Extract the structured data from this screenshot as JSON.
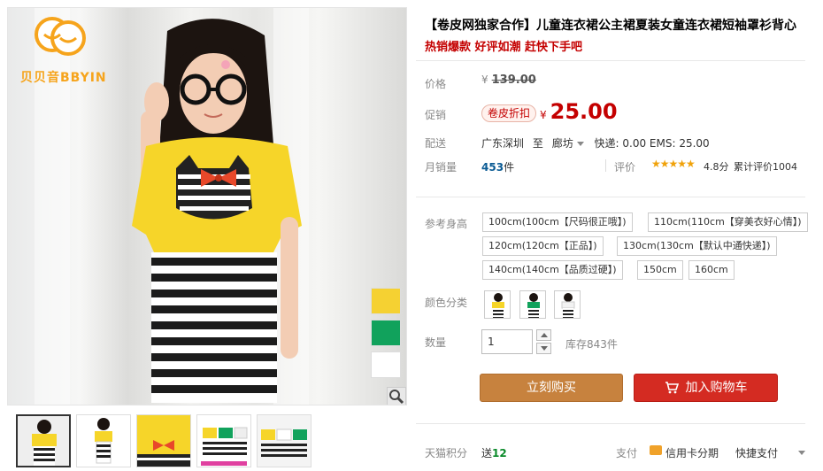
{
  "logo": {
    "brand_text": "贝贝音BBYIN"
  },
  "product": {
    "title": "【卷皮网独家合作】儿童连衣裙公主裙夏装女童连衣裙短袖罩衫背心",
    "subtitle": "热销爆款 好评如潮 赶快下手吧"
  },
  "price": {
    "label": "价格",
    "currency": "¥",
    "original": "139.00"
  },
  "promo": {
    "label": "促销",
    "badge": "卷皮折扣",
    "currency": "¥",
    "price": "25.00"
  },
  "shipping": {
    "label": "配送",
    "from": "广东深圳",
    "to_word": "至",
    "destination": "廊坊",
    "fees": "快递: 0.00 EMS: 25.00"
  },
  "sales": {
    "label": "月销量",
    "count": "453",
    "unit": "件",
    "rating_label": "评价",
    "stars": "★★★★★",
    "score": "4.8分",
    "review_count": "累计评价1004"
  },
  "size": {
    "label": "参考身高",
    "options": [
      "100cm(100cm【尺码很正哦】)",
      "110cm(110cm【穿美衣好心情】)",
      "120cm(120cm【正品】)",
      "130cm(130cm【默认中通快递】)",
      "140cm(140cm【品质过硬】)",
      "150cm",
      "160cm"
    ]
  },
  "color": {
    "label": "颜色分类"
  },
  "quantity": {
    "label": "数量",
    "value": "1",
    "stock": "库存843件"
  },
  "actions": {
    "buy_now": "立刻购买",
    "add_to_cart": "加入购物车"
  },
  "footer": {
    "points_label": "天猫积分",
    "points_prefix": "送",
    "points_value": "12",
    "pay_label": "支付",
    "card_text": "信用卡分期",
    "quick_pay": "快捷支付"
  },
  "colors": {
    "accent_red": "#c40000",
    "buy_button": "#c7823e",
    "cart_button": "#d42b22",
    "swatch_yellow": "#f5d132",
    "swatch_green": "#11a25c",
    "swatch_white": "#ffffff"
  }
}
